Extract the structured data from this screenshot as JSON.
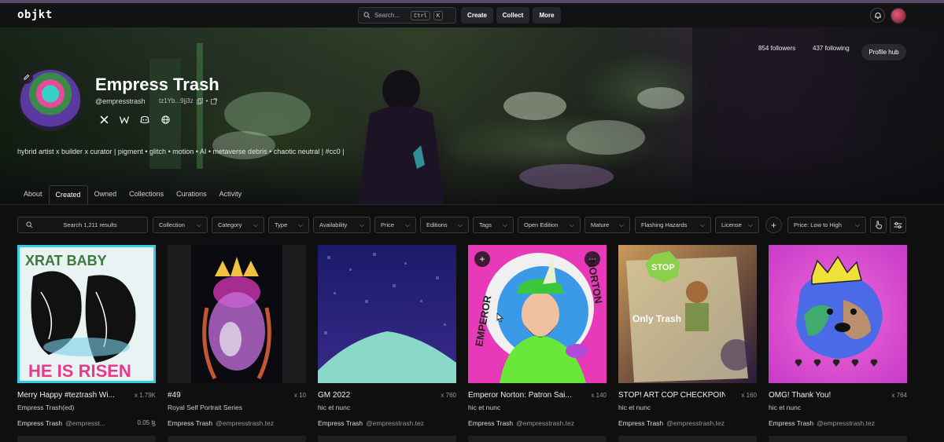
{
  "nav": {
    "logo": "objkt",
    "search_placeholder": "Search...",
    "kbd1": "Ctrl",
    "kbd2": "K",
    "create": "Create",
    "collect": "Collect",
    "more": "More"
  },
  "profile": {
    "name": "Empress Trash",
    "handle": "@empresstrash",
    "address": "tz1Yb...9jj3z",
    "bio": "hybrid artist x builder x curator | pigment • glitch • motion • AI • metaverse debris • chaotic neutral | #cc0 |",
    "followers": "854 followers",
    "following": "437 following",
    "hub": "Profile hub"
  },
  "tabs": [
    "About",
    "Created",
    "Owned",
    "Collections",
    "Curations",
    "Activity"
  ],
  "filters": {
    "search_placeholder": "Search 1,211 results",
    "chips": [
      "Collection",
      "Category",
      "Type",
      "Availability",
      "Price",
      "Editions",
      "Tags",
      "Open Edition",
      "Mature",
      "Flashing Hazards",
      "License"
    ],
    "sort": "Price: Low to High"
  },
  "cards": [
    {
      "title": "Merry Happy #teztrash Wi...",
      "editions": "x 1.79K",
      "collection": "Empress Trash(ed)",
      "artist": "Empress Trash",
      "handle": "@empresst...",
      "price": "0.05 ꜩ"
    },
    {
      "title": "#49",
      "editions": "x 10",
      "collection": "Royal Self Portrait Series",
      "artist": "Empress Trash",
      "handle": "@empresstrash.tez",
      "price": ""
    },
    {
      "title": "GM 2022",
      "editions": "x 760",
      "collection": "hic et nunc",
      "artist": "Empress Trash",
      "handle": "@empresstrash.tez",
      "price": ""
    },
    {
      "title": "Emperor Norton: Patron Sai...",
      "editions": "x 140",
      "collection": "hic et nunc",
      "artist": "Empress Trash",
      "handle": "@empresstrash.tez",
      "price": ""
    },
    {
      "title": "STOP! ART COP CHECKPOINT",
      "editions": "x 160",
      "collection": "hic et nunc",
      "artist": "Empress Trash",
      "handle": "@empresstrash.tez",
      "price": ""
    },
    {
      "title": "OMG! Thank You!",
      "editions": "x 764",
      "collection": "hic et nunc",
      "artist": "Empress Trash",
      "handle": "@empresstrash.tez",
      "price": ""
    }
  ],
  "art_texts": {
    "c1_top": "XRAT BABY",
    "c1_bottom": "HE IS RISEN",
    "c4_left": "EMPEROR",
    "c4_right": "NORTON",
    "c5_sign": "STOP",
    "c5_text": "Only Trash"
  }
}
